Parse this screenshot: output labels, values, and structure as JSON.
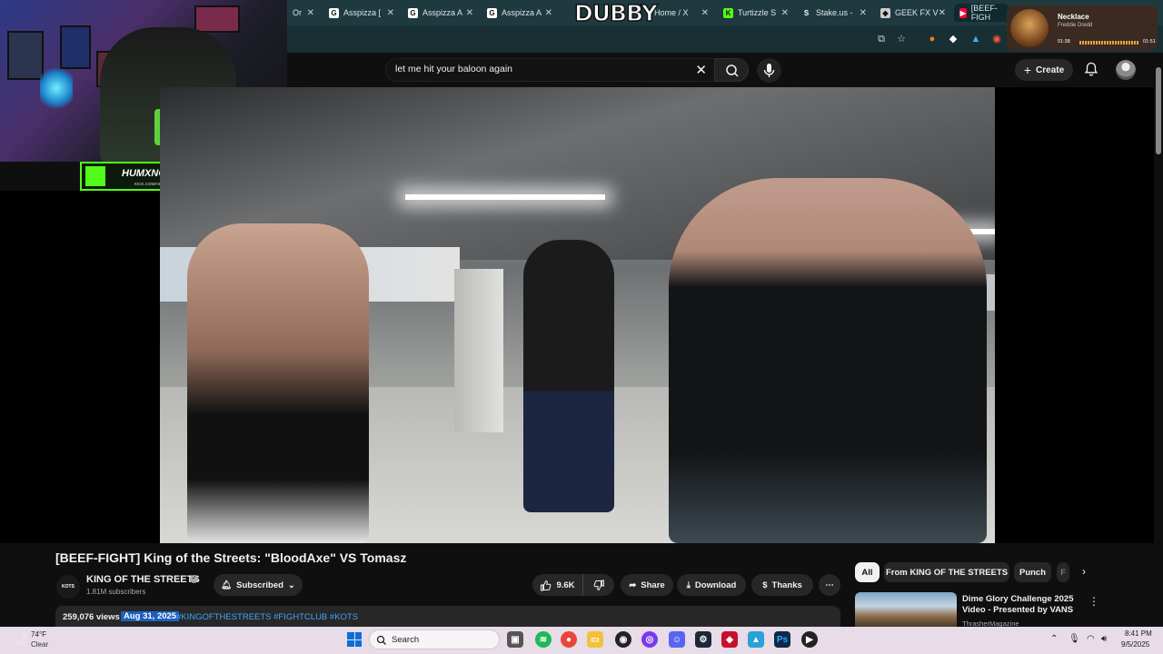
{
  "browser": {
    "tabs": [
      {
        "label": "Or",
        "favicon": "generic-icon",
        "active": false
      },
      {
        "label": "Asspizza [",
        "favicon": "g-icon",
        "active": false
      },
      {
        "label": "Asspizza A",
        "favicon": "g-icon",
        "active": false
      },
      {
        "label": "Asspizza A",
        "favicon": "g-icon",
        "active": false
      },
      {
        "label": "Home / X",
        "favicon": "x-icon",
        "active": false
      },
      {
        "label": "Turtizzle S",
        "favicon": "kick-icon",
        "active": false
      },
      {
        "label": "Stake.us -",
        "favicon": "s-icon",
        "active": false
      },
      {
        "label": "GEEK FX V",
        "favicon": "geek-icon",
        "active": false
      },
      {
        "label": "[BEEF-FIGH",
        "favicon": "youtube-icon",
        "active": true
      }
    ],
    "overlay_logo": "DUBBY"
  },
  "now_playing": {
    "title": "Necklace",
    "artist": "Freddie Dredd",
    "elapsed": "01:38",
    "total": "01:51"
  },
  "stream_overlay": {
    "name": "HUMXNGHXST",
    "url": "KICK.COM/HUMXNGHXST",
    "accent": "#53fc18"
  },
  "youtube": {
    "search": {
      "value": "let me hit your baloon again"
    },
    "create_label": "Create",
    "video": {
      "title": "[BEEF-FIGHT] King of the Streets: \"BloodAxe\" VS Tomasz",
      "channel_name": "KING OF THE STREETS",
      "channel_avatar_text": "KOTS",
      "subscribers": "1.81M subscribers",
      "subscribed_label": "Subscribed",
      "likes": "9.6K",
      "share_label": "Share",
      "download_label": "Download",
      "thanks_label": "Thanks",
      "views": "259,076 views",
      "date": "Aug 31, 2025",
      "tags": "#KINGOFTHESTREETS #FIGHTCLUB #KOTS"
    },
    "chips": [
      "All",
      "From KING OF THE STREETS",
      "Punch",
      "F"
    ],
    "recommendation": {
      "title": "Dime Glory Challenge 2025 Video - Presented by VANS",
      "channel": "ThrasherMagazine"
    }
  },
  "taskbar": {
    "weather_temp": "74°F",
    "weather_cond": "Clear",
    "search_label": "Search",
    "time": "8:41 PM",
    "date": "9/5/2025"
  },
  "colors": {
    "yt_bg": "#0f0f0f",
    "link_blue": "#3ea6ff",
    "date_highlight": "#1d5fbf"
  }
}
